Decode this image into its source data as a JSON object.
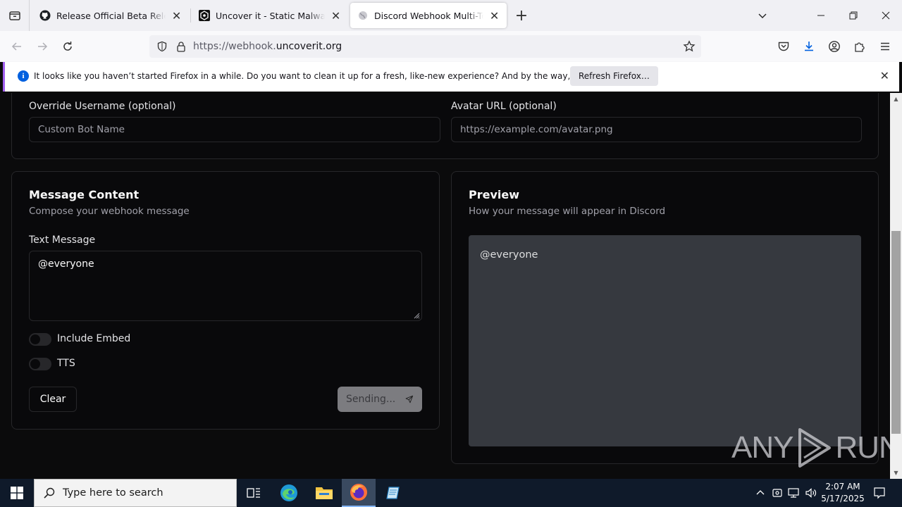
{
  "browser": {
    "tabs": [
      {
        "title": "Release Official Beta Release! · B",
        "icon": "github-icon",
        "active": false
      },
      {
        "title": "Uncover it - Static Malware Con",
        "icon": "uncoverit-icon",
        "active": false
      },
      {
        "title": "Discord Webhook Multi-Tool",
        "icon": "globe-icon",
        "active": true
      }
    ],
    "url_prefix": "https://webhook.",
    "url_domain": "uncoverit.org",
    "notification": {
      "message": "It looks like you haven’t started Firefox in a while. Do you want to clean it up for a fresh, like-new experience? And by the way, welcome back!",
      "button": "Refresh Firefox…"
    }
  },
  "identity": {
    "username_label": "Override Username (optional)",
    "username_placeholder": "Custom Bot Name",
    "avatar_label": "Avatar URL (optional)",
    "avatar_placeholder": "https://example.com/avatar.png"
  },
  "message": {
    "title": "Message Content",
    "description": "Compose your webhook message",
    "text_label": "Text Message",
    "text_value": "@everyone",
    "embed_label": "Include Embed",
    "embed_on": false,
    "tts_label": "TTS",
    "tts_on": false,
    "clear_button": "Clear",
    "send_button": "Sending..."
  },
  "preview": {
    "title": "Preview",
    "description": "How your message will appear in Discord",
    "content": "@everyone"
  },
  "watermark": {
    "left": "ANY",
    "right": "RUN"
  },
  "taskbar": {
    "search_placeholder": "Type here to search",
    "time": "2:07 AM",
    "date": "5/17/2025"
  },
  "colors": {
    "page_bg": "#0b0b0c",
    "card_border": "#27272a",
    "preview_bg": "#36393f",
    "accent_notif": "#a260f0",
    "info_blue": "#0060df"
  }
}
